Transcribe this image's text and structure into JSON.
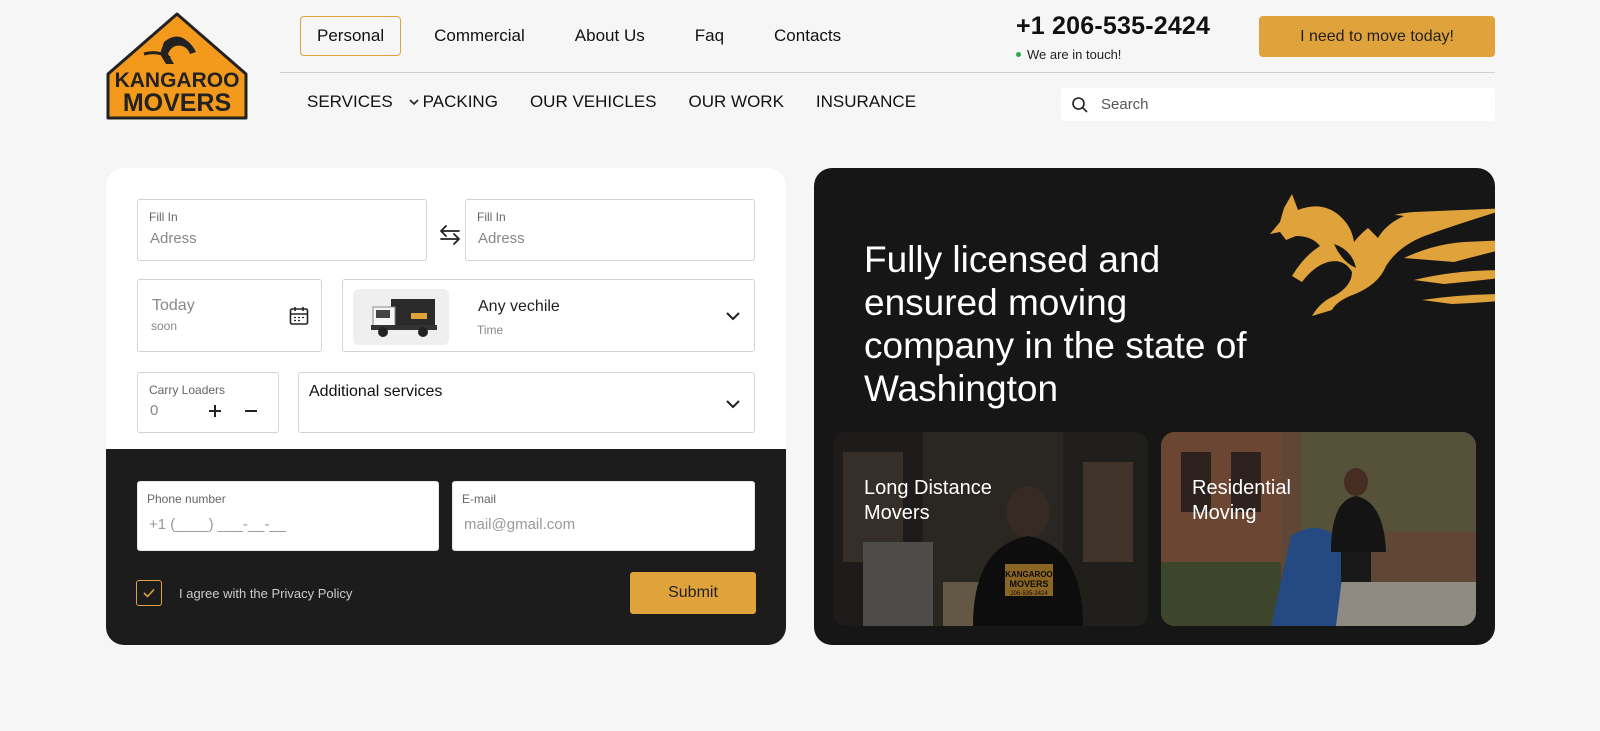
{
  "brand": {
    "logo_line1": "KANGAROO",
    "logo_line2": "MOVERS",
    "accent": "#e0a23a",
    "dark": "#1c1c1c"
  },
  "header": {
    "top_links": [
      "Personal",
      "Commercial",
      "About Us",
      "Faq",
      "Contacts"
    ],
    "active_link": "Personal",
    "phone": "+1 206-535-2424",
    "status": "We are in touch!",
    "cta": "I need to move today!",
    "nav": [
      "SERVICES",
      "PACKING",
      "OUR VEHICLES",
      "OUR WORK",
      "INSURANCE"
    ],
    "search_placeholder": "Search"
  },
  "form": {
    "from": {
      "label": "Fill In",
      "placeholder": "Adress"
    },
    "to": {
      "label": "Fill In",
      "placeholder": "Adress"
    },
    "date": {
      "value": "Today",
      "sub": "soon"
    },
    "vehicle": {
      "value": "Any vechile",
      "sub": "Time"
    },
    "loaders": {
      "label": "Carry Loaders",
      "value": "0"
    },
    "additional": {
      "label": "Additional services"
    },
    "phone": {
      "label": "Phone number",
      "placeholder": "+1 (____) ___-__-__"
    },
    "email": {
      "label": "E-mail",
      "placeholder": "mail@gmail.com"
    },
    "agree": "I agree with the Privacy Policy",
    "agree_checked": true,
    "submit": "Submit"
  },
  "hero": {
    "title": "Fully licensed and ensured moving company in the state of Washington",
    "tiles": [
      {
        "title": "Long Distance Movers",
        "shirt_line1": "KANGAROO",
        "shirt_line2": "MOVERS",
        "shirt_line3": "206-535-2424"
      },
      {
        "title": "Residential Moving"
      }
    ]
  }
}
